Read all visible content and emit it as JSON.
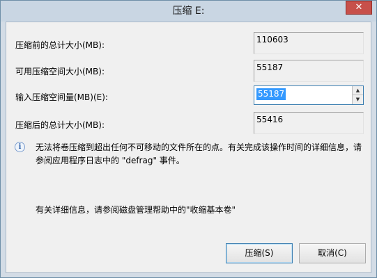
{
  "window": {
    "title": "压缩 E:",
    "close_label": "✕"
  },
  "fields": {
    "total_before_label": "压缩前的总计大小(MB):",
    "total_before_value": "110603",
    "available_label": "可用压缩空间大小(MB):",
    "available_value": "55187",
    "input_label": "输入压缩空间量(MB)(E):",
    "input_value": "55187",
    "total_after_label": "压缩后的总计大小(MB):",
    "total_after_value": "55416"
  },
  "info": {
    "icon": "info-icon",
    "text": "无法将卷压缩到超出任何不可移动的文件所在的点。有关完成该操作时间的详细信息，请参阅应用程序日志中的 \"defrag\" 事件。",
    "help": "有关详细信息，请参阅磁盘管理帮助中的\"收缩基本卷\""
  },
  "buttons": {
    "shrink": "压缩(S)",
    "cancel": "取消(C)"
  },
  "colors": {
    "title_bar": "#c9d6e3",
    "close_button": "#c7504a",
    "selection": "#3399ff",
    "focus_border": "#3c7fb1"
  }
}
